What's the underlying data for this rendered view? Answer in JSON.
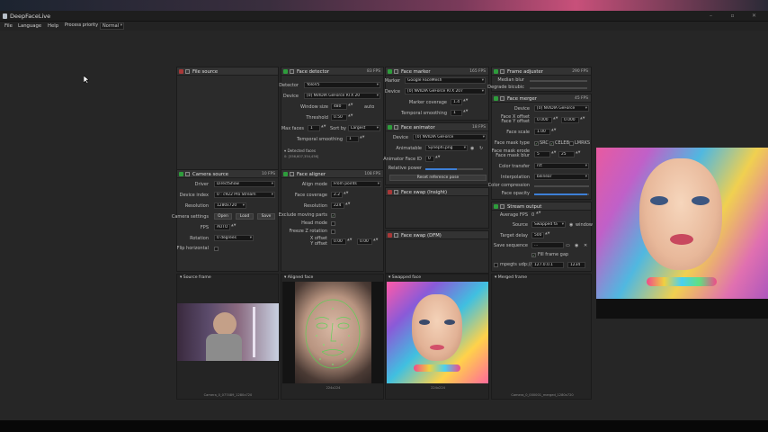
{
  "app": {
    "title": "DeepFaceLive"
  },
  "menu": {
    "items": [
      "File",
      "Language",
      "Help"
    ],
    "process_priority_label": "Process priority",
    "process_priority_value": "Normal"
  },
  "colors": {
    "accent": "#3d7fd6",
    "power_on": "#2e9c3c",
    "power_off": "#a83838"
  },
  "file_source": {
    "title": "File source"
  },
  "face_detector": {
    "title": "Face detector",
    "fps": "83 FPS",
    "detector_label": "Detector",
    "detector_value": "YoloV5",
    "device_label": "Device",
    "device_value": "[0] NVIDIA GeForce RTX 20",
    "window_size_label": "Window size",
    "window_size_value": "480",
    "window_size_auto": "auto",
    "threshold_label": "Threshold",
    "threshold_value": "0.50",
    "max_faces_label": "Max faces",
    "max_faces_value": "1",
    "sort_by_label": "Sort by",
    "sort_by_value": "Largest",
    "temporal_label": "Temporal smoothing",
    "temporal_value": "1",
    "detected_label": "Detected faces",
    "detected_value": "0: [556,607,354,456]"
  },
  "face_marker": {
    "title": "Face marker",
    "fps": "165 FPS",
    "marker_label": "Marker",
    "marker_value": "Google FaceMesh",
    "device_label": "Device",
    "device_value": "[0] NVIDIA GeForce RTX 207",
    "coverage_label": "Marker coverage",
    "coverage_value": "1.4",
    "temporal_label": "Temporal smoothing",
    "temporal_value": "1"
  },
  "frame_adjuster": {
    "title": "Frame adjuster",
    "fps": "290 FPS",
    "median_label": "Median blur",
    "degrade_label": "Degrade bicubic"
  },
  "face_merger": {
    "title": "Face merger",
    "fps": "45 FPS",
    "device_label": "Device",
    "device_value": "[0] NVIDIA GeForce",
    "xoff_label": "Face X offset",
    "yoff_label": "Face Y offset",
    "xoff_value": "0.000",
    "yoff_value": "0.000",
    "scale_label": "Face scale",
    "scale_value": "1.00",
    "mask_type_label": "Face mask type",
    "mask_src": "SRC",
    "mask_celeb": "CELEB",
    "mask_lmrks": "LMRKS",
    "erode_label": "Face mask erode",
    "blur_label": "Face mask blur",
    "erode_value": "5",
    "blur_value": "25",
    "color_transfer_label": "Color transfer",
    "color_transfer_value": "rct",
    "interp_label": "Interpolation",
    "interp_value": "bilinear",
    "compression_label": "Color compression",
    "opacity_label": "Face opacity",
    "opacity_level": 0.96
  },
  "face_animator": {
    "title": "Face animator",
    "fps": "18 FPS",
    "device_label": "Device",
    "device_value": "[0] NVIDIA GeForce",
    "animatable_label": "Animatable",
    "animatable_value": "Synephi.png",
    "face_id_label": "Animator Face ID",
    "face_id_value": "0",
    "rel_power_label": "Relative power",
    "rel_power_level": 0.55,
    "reset_button": "Reset reference pose"
  },
  "face_swap_insight": {
    "title": "Face swap (Insight)"
  },
  "face_swap_dfm": {
    "title": "Face swap (DFM)"
  },
  "stream_output": {
    "title": "Stream output",
    "avg_fps_label": "Average FPS",
    "avg_fps_value": "0",
    "source_label": "Source",
    "source_value": "Swapped fa",
    "window_label": "window",
    "delay_label": "Target delay",
    "delay_value": "500",
    "save_seq_label": "Save sequence",
    "save_seq_value": "...",
    "fill_gap_label": "Fill frame gap",
    "mpegts_label": "mpegts udp://",
    "mpegts_host": "127.0.0.1",
    "mpegts_port": "1234"
  },
  "camera_source": {
    "title": "Camera source",
    "fps": "10 FPS",
    "driver_label": "Driver",
    "driver_value": "DirectShow",
    "device_index_label": "Device index",
    "device_index_value": "0 : c922 Pro Stream",
    "resolution_label": "Resolution",
    "resolution_value": "1280x720",
    "settings_label": "Camera settings",
    "open_button": "Open",
    "load_button": "Load",
    "save_button": "Save",
    "fps_label": "FPS",
    "fps_value": "AUTO",
    "rotation_label": "Rotation",
    "rotation_value": "0 degrees",
    "flip_label": "Flip horizontal"
  },
  "face_aligner": {
    "title": "Face aligner",
    "fps": "108 FPS",
    "align_mode_label": "Align mode",
    "align_mode_value": "From points",
    "coverage_label": "Face coverage",
    "coverage_value": "2.2",
    "resolution_label": "Resolution",
    "resolution_value": "224",
    "exclude_label": "Exclude moving parts",
    "head_mode_label": "Head mode",
    "freeze_label": "Freeze Z rotation",
    "xoff_label": "X offset",
    "yoff_label": "Y offset",
    "xoff_value": "0.00",
    "yoff_value": "0.00"
  },
  "viewers": {
    "source_title": "Source frame",
    "aligned_title": "Aligned face",
    "swapped_title": "Swapped face",
    "merged_title": "Merged frame",
    "source_caption": "Camera_0_077489_1280x720",
    "aligned_caption": "224x224",
    "swapped_caption": "224x224",
    "merged_caption": "Camera_0_000001_merged_1280x720"
  }
}
